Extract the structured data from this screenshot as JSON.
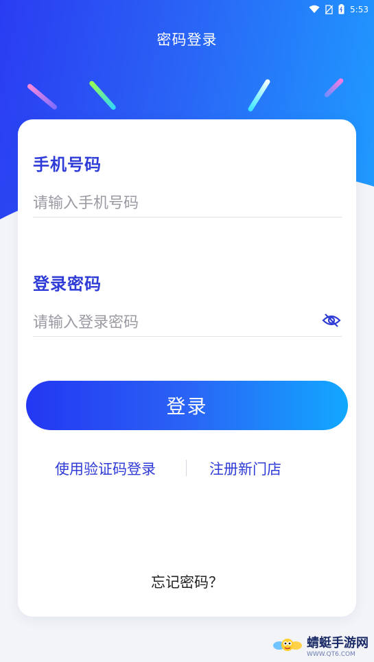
{
  "status_bar": {
    "time": "5:53"
  },
  "header": {
    "title": "密码登录"
  },
  "phone": {
    "label": "手机号码",
    "placeholder": "请输入手机号码",
    "value": ""
  },
  "password": {
    "label": "登录密码",
    "placeholder": "请输入登录密码",
    "value": ""
  },
  "actions": {
    "login_label": "登录",
    "sms_login_label": "使用验证码登录",
    "register_label": "注册新门店",
    "forgot_label": "忘记密码？"
  },
  "watermark": {
    "text": "蜻蜓手游网",
    "sub": "WWW.QT6.COM"
  },
  "colors": {
    "primary": "#2f3bd6",
    "gradient_start": "#2337f2",
    "gradient_end": "#12a8ff"
  }
}
